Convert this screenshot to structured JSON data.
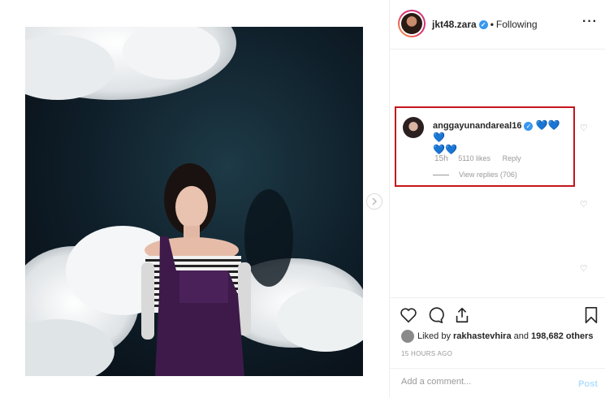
{
  "post": {
    "image_alt": "Post photo"
  },
  "header": {
    "username": "jkt48.zara",
    "separator": "•",
    "follow_status": "Following",
    "more_icon": "more-horizontal-icon"
  },
  "highlighted_comment": {
    "username": "anggayunandareal16",
    "emoji": [
      "💙",
      "💙",
      "💙",
      "💙",
      "💙"
    ],
    "age": "15h",
    "likes": "5110 likes",
    "reply_label": "Reply",
    "view_replies": "View replies (706)",
    "highlight_color": "#c4161c"
  },
  "actions": {
    "like_icon": "heart-outline-icon",
    "comment_icon": "comment-bubble-icon",
    "share_icon": "share-arrow-icon",
    "save_icon": "bookmark-icon"
  },
  "liked_by": {
    "prefix": "Liked by ",
    "user": "rakhastevhira",
    "middle": " and ",
    "others": "198,682 others"
  },
  "timestamp": "15 HOURS AGO",
  "add_comment": {
    "placeholder": "Add a comment...",
    "post_label": "Post"
  },
  "colors": {
    "verified": "#3897f0",
    "link_muted": "#999999",
    "post_button_disabled": "#b2dffc"
  }
}
